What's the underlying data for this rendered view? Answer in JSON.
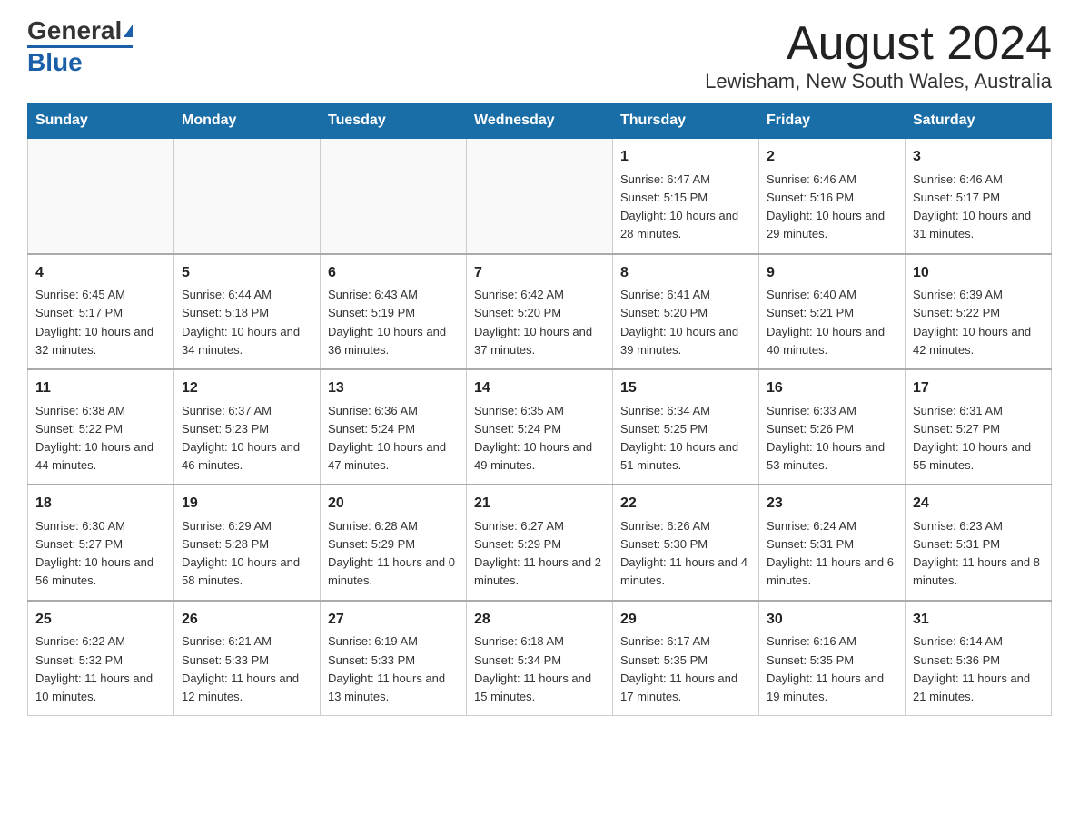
{
  "header": {
    "logo_general": "General",
    "logo_blue": "Blue",
    "month_title": "August 2024",
    "location": "Lewisham, New South Wales, Australia"
  },
  "days_of_week": [
    "Sunday",
    "Monday",
    "Tuesday",
    "Wednesday",
    "Thursday",
    "Friday",
    "Saturday"
  ],
  "weeks": [
    [
      {
        "day": "",
        "info": ""
      },
      {
        "day": "",
        "info": ""
      },
      {
        "day": "",
        "info": ""
      },
      {
        "day": "",
        "info": ""
      },
      {
        "day": "1",
        "info": "Sunrise: 6:47 AM\nSunset: 5:15 PM\nDaylight: 10 hours and 28 minutes."
      },
      {
        "day": "2",
        "info": "Sunrise: 6:46 AM\nSunset: 5:16 PM\nDaylight: 10 hours and 29 minutes."
      },
      {
        "day": "3",
        "info": "Sunrise: 6:46 AM\nSunset: 5:17 PM\nDaylight: 10 hours and 31 minutes."
      }
    ],
    [
      {
        "day": "4",
        "info": "Sunrise: 6:45 AM\nSunset: 5:17 PM\nDaylight: 10 hours and 32 minutes."
      },
      {
        "day": "5",
        "info": "Sunrise: 6:44 AM\nSunset: 5:18 PM\nDaylight: 10 hours and 34 minutes."
      },
      {
        "day": "6",
        "info": "Sunrise: 6:43 AM\nSunset: 5:19 PM\nDaylight: 10 hours and 36 minutes."
      },
      {
        "day": "7",
        "info": "Sunrise: 6:42 AM\nSunset: 5:20 PM\nDaylight: 10 hours and 37 minutes."
      },
      {
        "day": "8",
        "info": "Sunrise: 6:41 AM\nSunset: 5:20 PM\nDaylight: 10 hours and 39 minutes."
      },
      {
        "day": "9",
        "info": "Sunrise: 6:40 AM\nSunset: 5:21 PM\nDaylight: 10 hours and 40 minutes."
      },
      {
        "day": "10",
        "info": "Sunrise: 6:39 AM\nSunset: 5:22 PM\nDaylight: 10 hours and 42 minutes."
      }
    ],
    [
      {
        "day": "11",
        "info": "Sunrise: 6:38 AM\nSunset: 5:22 PM\nDaylight: 10 hours and 44 minutes."
      },
      {
        "day": "12",
        "info": "Sunrise: 6:37 AM\nSunset: 5:23 PM\nDaylight: 10 hours and 46 minutes."
      },
      {
        "day": "13",
        "info": "Sunrise: 6:36 AM\nSunset: 5:24 PM\nDaylight: 10 hours and 47 minutes."
      },
      {
        "day": "14",
        "info": "Sunrise: 6:35 AM\nSunset: 5:24 PM\nDaylight: 10 hours and 49 minutes."
      },
      {
        "day": "15",
        "info": "Sunrise: 6:34 AM\nSunset: 5:25 PM\nDaylight: 10 hours and 51 minutes."
      },
      {
        "day": "16",
        "info": "Sunrise: 6:33 AM\nSunset: 5:26 PM\nDaylight: 10 hours and 53 minutes."
      },
      {
        "day": "17",
        "info": "Sunrise: 6:31 AM\nSunset: 5:27 PM\nDaylight: 10 hours and 55 minutes."
      }
    ],
    [
      {
        "day": "18",
        "info": "Sunrise: 6:30 AM\nSunset: 5:27 PM\nDaylight: 10 hours and 56 minutes."
      },
      {
        "day": "19",
        "info": "Sunrise: 6:29 AM\nSunset: 5:28 PM\nDaylight: 10 hours and 58 minutes."
      },
      {
        "day": "20",
        "info": "Sunrise: 6:28 AM\nSunset: 5:29 PM\nDaylight: 11 hours and 0 minutes."
      },
      {
        "day": "21",
        "info": "Sunrise: 6:27 AM\nSunset: 5:29 PM\nDaylight: 11 hours and 2 minutes."
      },
      {
        "day": "22",
        "info": "Sunrise: 6:26 AM\nSunset: 5:30 PM\nDaylight: 11 hours and 4 minutes."
      },
      {
        "day": "23",
        "info": "Sunrise: 6:24 AM\nSunset: 5:31 PM\nDaylight: 11 hours and 6 minutes."
      },
      {
        "day": "24",
        "info": "Sunrise: 6:23 AM\nSunset: 5:31 PM\nDaylight: 11 hours and 8 minutes."
      }
    ],
    [
      {
        "day": "25",
        "info": "Sunrise: 6:22 AM\nSunset: 5:32 PM\nDaylight: 11 hours and 10 minutes."
      },
      {
        "day": "26",
        "info": "Sunrise: 6:21 AM\nSunset: 5:33 PM\nDaylight: 11 hours and 12 minutes."
      },
      {
        "day": "27",
        "info": "Sunrise: 6:19 AM\nSunset: 5:33 PM\nDaylight: 11 hours and 13 minutes."
      },
      {
        "day": "28",
        "info": "Sunrise: 6:18 AM\nSunset: 5:34 PM\nDaylight: 11 hours and 15 minutes."
      },
      {
        "day": "29",
        "info": "Sunrise: 6:17 AM\nSunset: 5:35 PM\nDaylight: 11 hours and 17 minutes."
      },
      {
        "day": "30",
        "info": "Sunrise: 6:16 AM\nSunset: 5:35 PM\nDaylight: 11 hours and 19 minutes."
      },
      {
        "day": "31",
        "info": "Sunrise: 6:14 AM\nSunset: 5:36 PM\nDaylight: 11 hours and 21 minutes."
      }
    ]
  ]
}
